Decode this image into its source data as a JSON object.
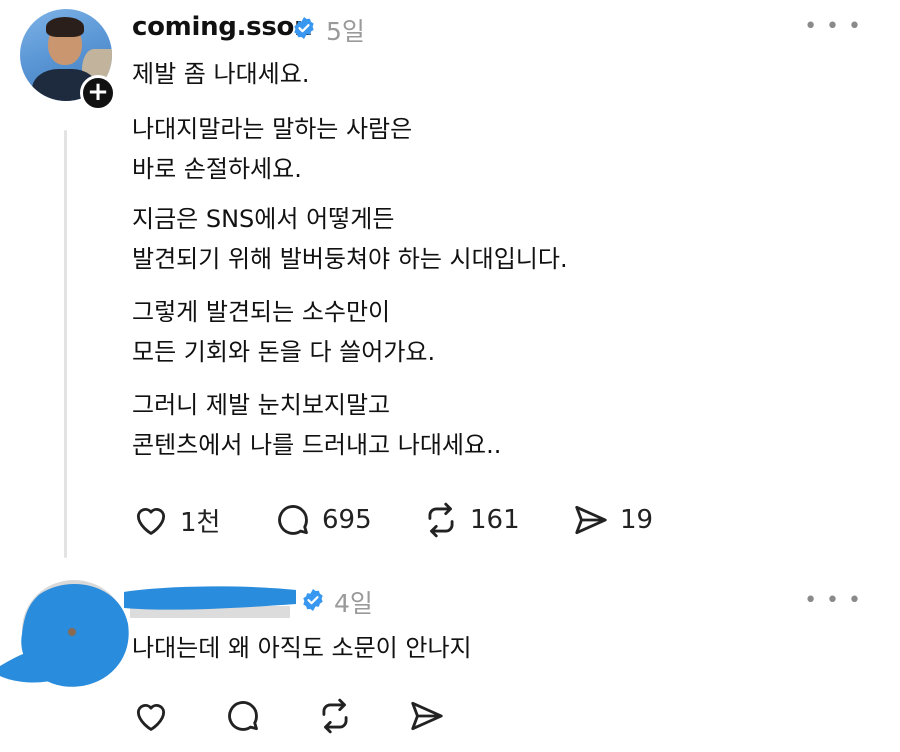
{
  "post": {
    "username": "coming.sson",
    "time": "5일",
    "paragraphs": [
      "제발 좀 나대세요.",
      "나대지말라는 말하는 사람은\n바로 손절하세요.",
      "지금은 SNS에서 어떻게든\n발견되기 위해 발버둥쳐야 하는 시대입니다.",
      "그렇게 발견되는 소수만이\n모든 기회와 돈을 다 쓸어가요.",
      "그러니 제발 눈치보지말고\n콘텐츠에서 나를 드러내고 나대세요.."
    ],
    "likes": "1천",
    "comments": "695",
    "reposts": "161",
    "shares": "19",
    "more_label": "• • •",
    "follow_label": "+"
  },
  "reply": {
    "time": "4일",
    "text": "나대는데 왜 아직도 소문이 안나지",
    "more_label": "• • •"
  },
  "icons": {
    "like": "heart-icon",
    "comment": "comment-icon",
    "repost": "repost-icon",
    "share": "send-icon",
    "verified": "verified-badge-icon"
  },
  "colors": {
    "verified_blue": "#3897f0",
    "redaction_blue": "#2a8cdc",
    "meta_gray": "#9a9a9a"
  }
}
